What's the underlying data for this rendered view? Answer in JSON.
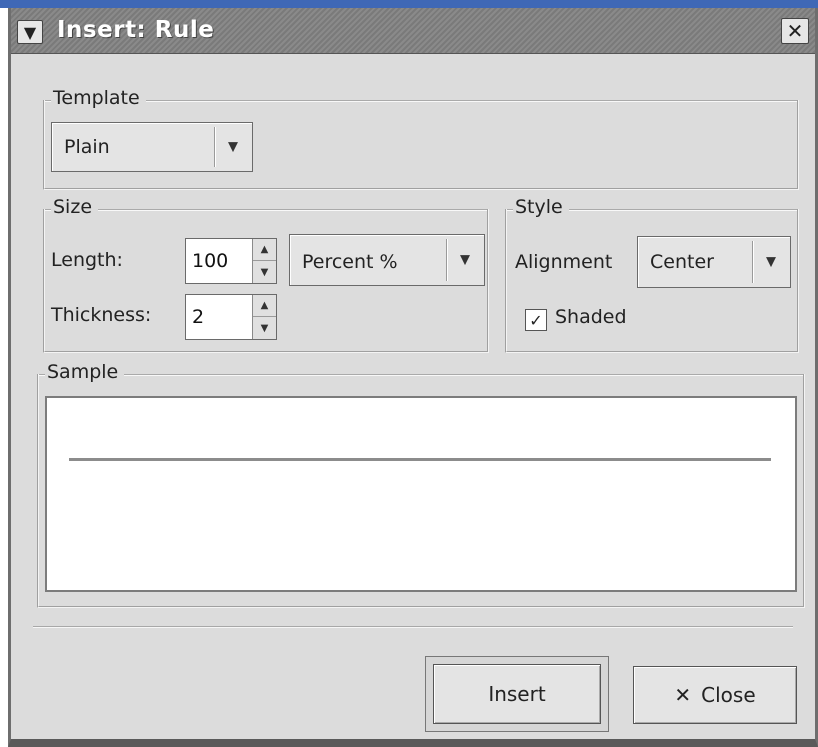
{
  "window": {
    "title": "Insert: Rule",
    "menu_icon": "chevron-down-icon",
    "close_icon": "close-icon"
  },
  "template": {
    "legend": "Template",
    "selected": "Plain",
    "arrow_icon": "chevron-down-icon"
  },
  "size": {
    "legend": "Size",
    "length_label": "Length:",
    "length_value": "100",
    "unit_selected": "Percent %",
    "thickness_label": "Thickness:",
    "thickness_value": "2"
  },
  "style": {
    "legend": "Style",
    "alignment_label": "Alignment",
    "alignment_selected": "Center",
    "shaded_label": "Shaded",
    "shaded_checked": true
  },
  "sample": {
    "legend": "Sample"
  },
  "buttons": {
    "insert": "Insert",
    "close": "Close"
  },
  "colors": {
    "titlebar_accent": "#3f68b6",
    "dialog_bg": "#dcdcdc",
    "sample_rule": "#8c8c8c"
  }
}
